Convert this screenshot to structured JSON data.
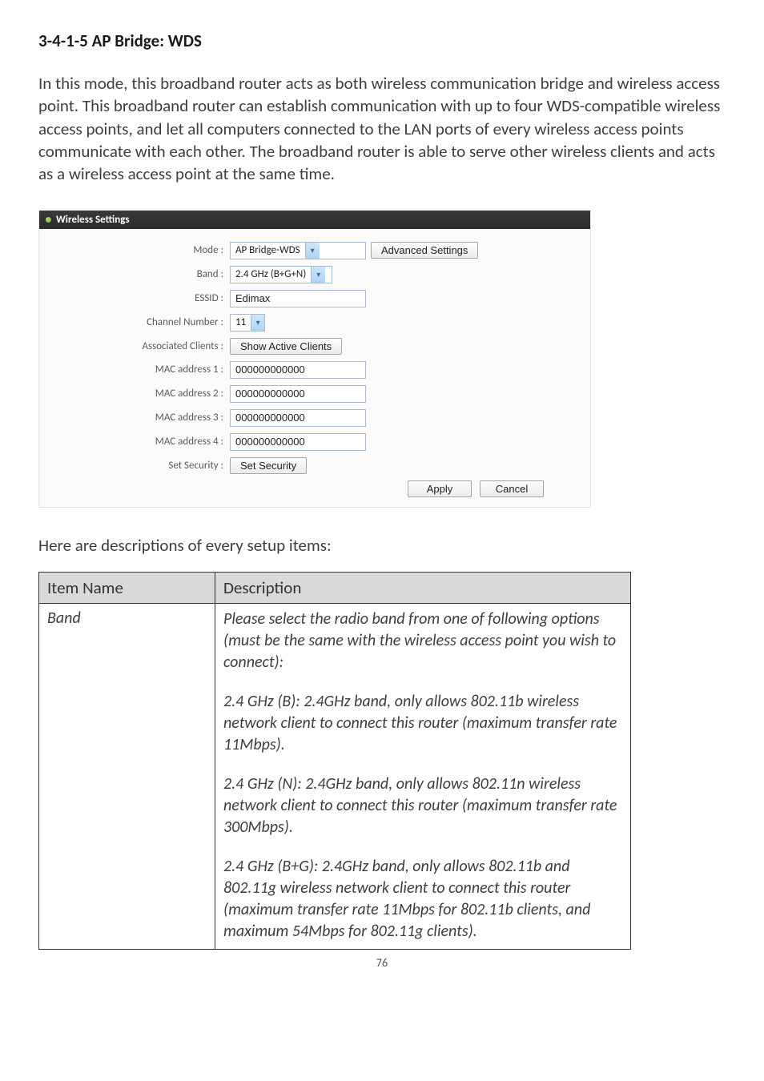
{
  "heading": "3-4-1-5 AP Bridge: WDS",
  "intro": "In this mode, this broadband router acts as both wireless communication bridge and wireless access point. This broadband router can establish communication with up to four WDS-compatible wireless access points, and let all computers connected to the LAN ports of every wireless access points communicate with each other. The broadband router is able to serve other wireless clients and acts as a wireless access point at the same time.",
  "panel": {
    "title": "Wireless Settings",
    "rows": {
      "mode_label": "Mode :",
      "mode_value": "AP Bridge-WDS",
      "adv_btn": "Advanced Settings",
      "band_label": "Band :",
      "band_value": "2.4 GHz (B+G+N)",
      "essid_label": "ESSID :",
      "essid_value": "Edimax",
      "chan_label": "Channel Number :",
      "chan_value": "11",
      "assoc_label": "Associated Clients :",
      "assoc_btn": "Show Active Clients",
      "mac1_label": "MAC address 1 :",
      "mac1_value": "000000000000",
      "mac2_label": "MAC address 2 :",
      "mac2_value": "000000000000",
      "mac3_label": "MAC address 3 :",
      "mac3_value": "000000000000",
      "mac4_label": "MAC address 4 :",
      "mac4_value": "000000000000",
      "sec_label": "Set Security :",
      "sec_btn": "Set Security",
      "apply_btn": "Apply",
      "cancel_btn": "Cancel"
    }
  },
  "desc_intro": "Here are descriptions of every setup items:",
  "table": {
    "th1": "Item Name",
    "th2": "Description",
    "band_name": "Band",
    "band_p1": "Please select the radio band from one of following options (must be the same with the wireless access point you wish to connect):",
    "band_p2": "2.4 GHz (B): 2.4GHz band, only allows 802.11b wireless network client to connect this router (maximum transfer rate 11Mbps).",
    "band_p3": "2.4 GHz (N): 2.4GHz band, only allows 802.11n wireless network client to connect this router (maximum transfer rate 300Mbps).",
    "band_p4": "2.4 GHz (B+G):    2.4GHz band, only allows 802.11b and 802.11g wireless network client to connect this router (maximum transfer rate 11Mbps for 802.11b clients, and maximum 54Mbps for 802.11g clients)."
  },
  "page_number": "76"
}
